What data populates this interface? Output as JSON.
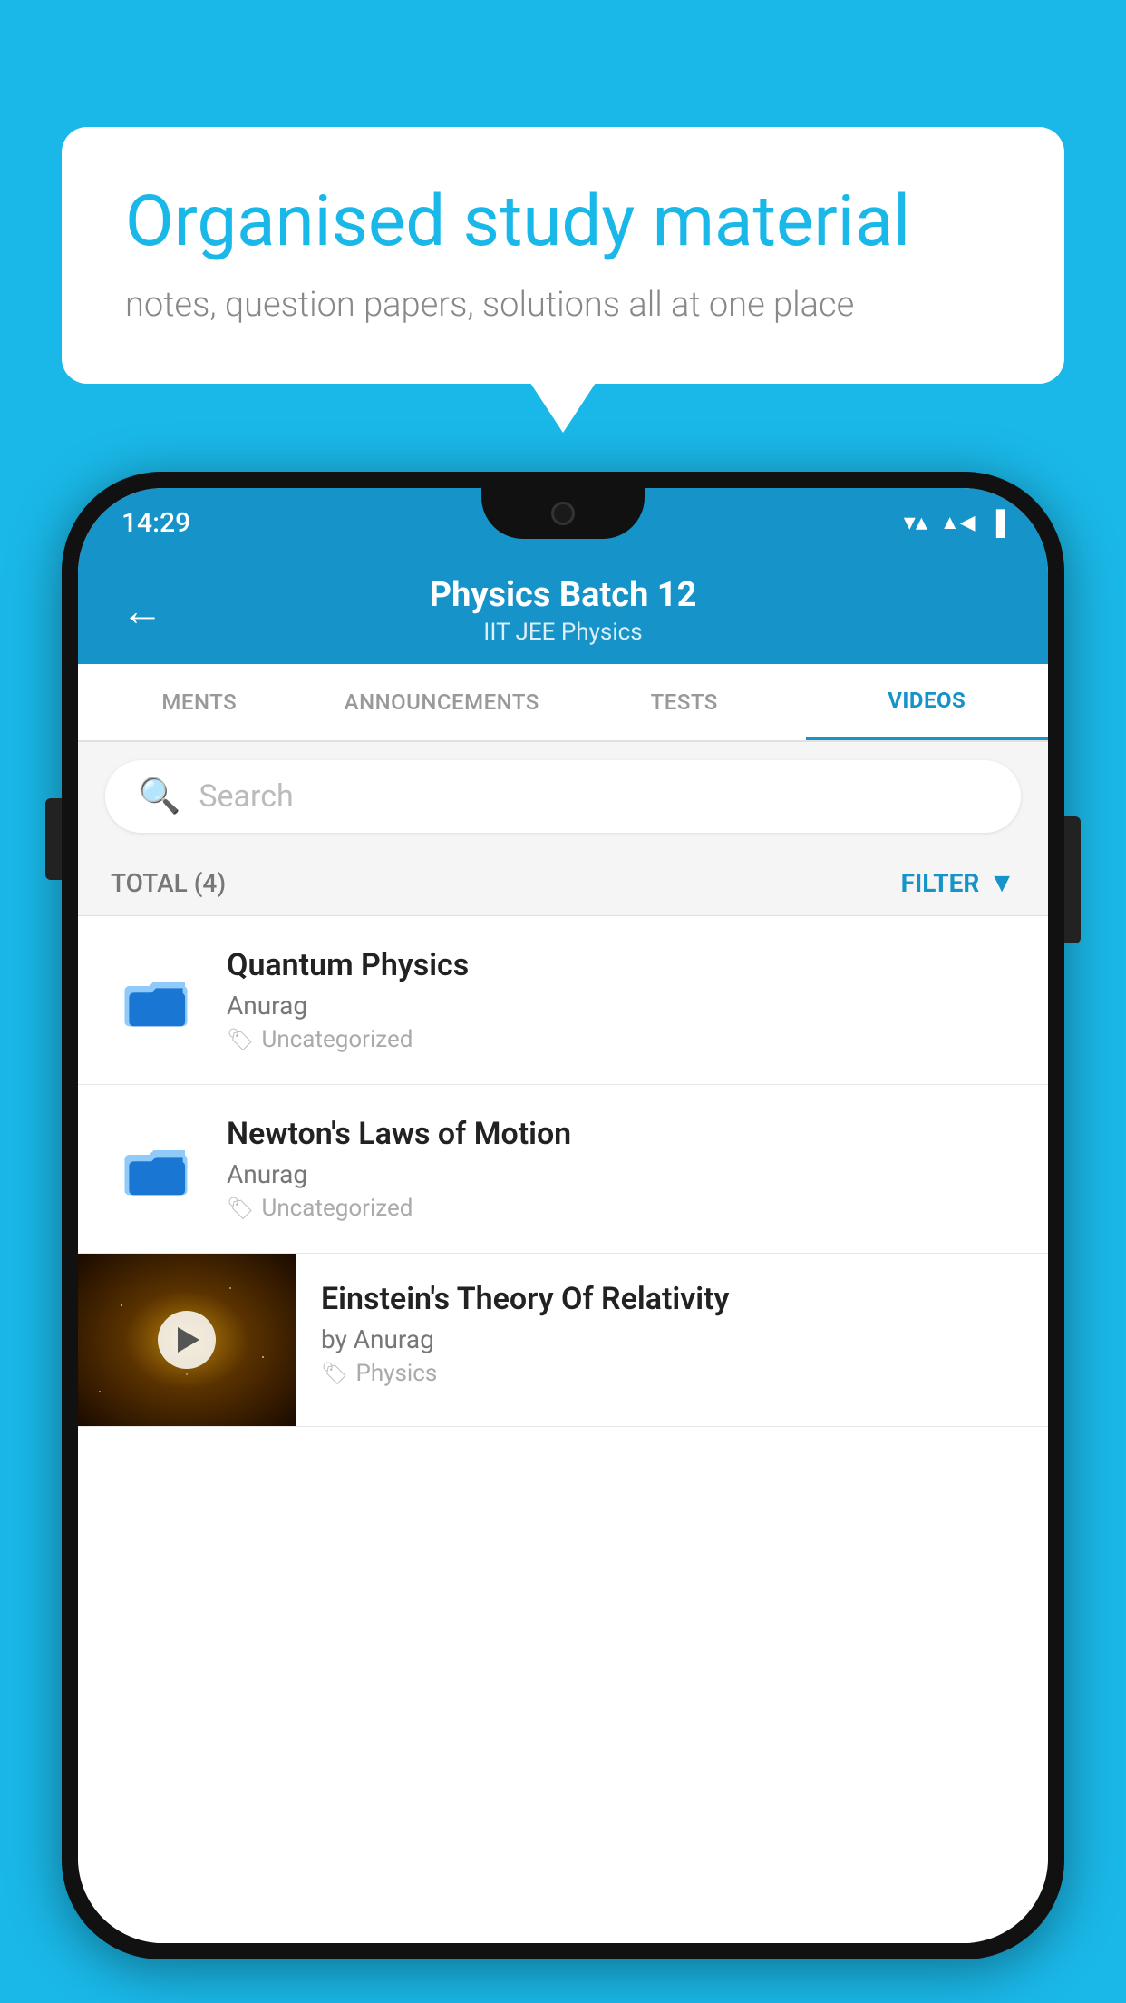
{
  "background_color": "#1ab8e8",
  "speech_bubble": {
    "title": "Organised study material",
    "subtitle": "notes, question papers, solutions all at one place"
  },
  "phone": {
    "status_bar": {
      "time": "14:29",
      "wifi": "▼▲",
      "signal": "▲",
      "battery": "▌"
    },
    "header": {
      "back_label": "←",
      "title": "Physics Batch 12",
      "subtitle": "IIT JEE   Physics"
    },
    "tabs": [
      {
        "label": "MENTS",
        "active": false
      },
      {
        "label": "ANNOUNCEMENTS",
        "active": false
      },
      {
        "label": "TESTS",
        "active": false
      },
      {
        "label": "VIDEOS",
        "active": true
      }
    ],
    "search": {
      "placeholder": "Search"
    },
    "filter": {
      "total_label": "TOTAL (4)",
      "filter_label": "FILTER"
    },
    "videos": [
      {
        "title": "Quantum Physics",
        "author": "Anurag",
        "tag": "Uncategorized",
        "has_thumb": false
      },
      {
        "title": "Newton's Laws of Motion",
        "author": "Anurag",
        "tag": "Uncategorized",
        "has_thumb": false
      },
      {
        "title": "Einstein's Theory Of Relativity",
        "author": "by Anurag",
        "tag": "Physics",
        "has_thumb": true
      }
    ]
  }
}
